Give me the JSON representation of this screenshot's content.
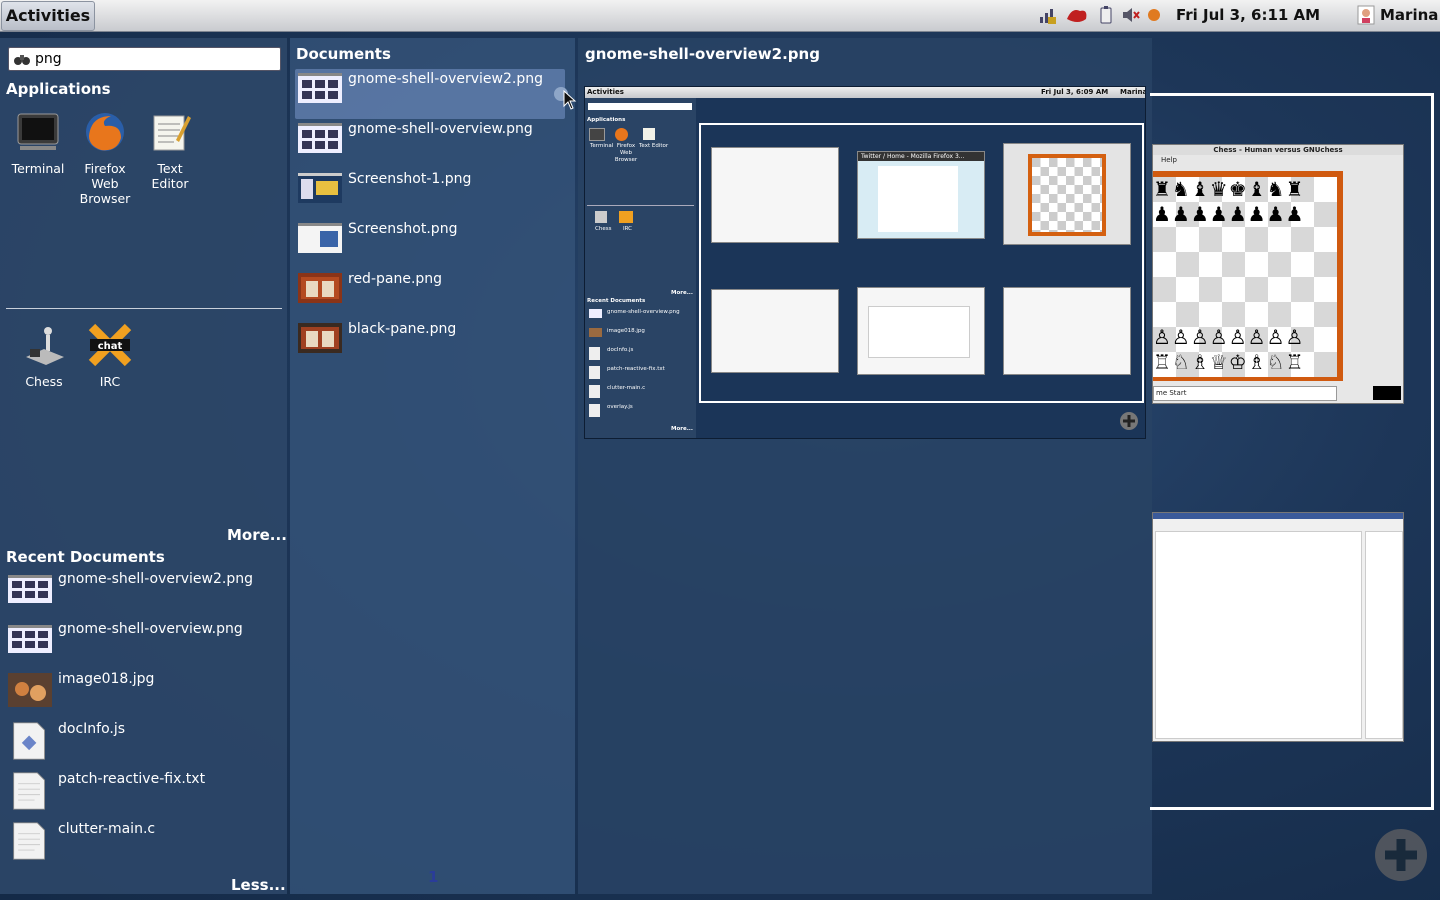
{
  "topbar": {
    "activities_label": "Activities",
    "clock": "Fri Jul  3,  6:11 AM",
    "user_name": "Marina"
  },
  "search": {
    "value": "png"
  },
  "applications": {
    "heading": "Applications",
    "items": [
      {
        "label": "Terminal"
      },
      {
        "label": "Firefox Web Browser"
      },
      {
        "label": "Text Editor"
      }
    ],
    "more_label": "More..."
  },
  "running_apps": [
    {
      "label": "Chess"
    },
    {
      "label": "IRC"
    }
  ],
  "recent_documents": {
    "heading": "Recent Documents",
    "items": [
      {
        "name": "gnome-shell-overview2.png"
      },
      {
        "name": "gnome-shell-overview.png"
      },
      {
        "name": "image018.jpg"
      },
      {
        "name": "docInfo.js"
      },
      {
        "name": "patch-reactive-fix.txt"
      },
      {
        "name": "clutter-main.c"
      }
    ],
    "less_label": "Less..."
  },
  "documents_pane": {
    "heading": "Documents",
    "items": [
      {
        "name": "gnome-shell-overview2.png"
      },
      {
        "name": "gnome-shell-overview.png"
      },
      {
        "name": "Screenshot-1.png"
      },
      {
        "name": "Screenshot.png"
      },
      {
        "name": "red-pane.png"
      },
      {
        "name": "black-pane.png"
      }
    ],
    "page_number": "1"
  },
  "preview": {
    "title": "gnome-shell-overview2.png",
    "inner_activities": "Activities",
    "inner_clock": "Fri Jul  3,  6:09 AM",
    "inner_user": "Marina",
    "inner_apps_heading": "Applications",
    "inner_apps": [
      "Terminal",
      "Firefox Web Browser",
      "Text Editor"
    ],
    "inner_running": [
      "Chess",
      "IRC"
    ],
    "inner_more": "More...",
    "inner_recent_heading": "Recent Documents",
    "inner_recent": [
      "gnome-shell-overview.png",
      "image018.jpg",
      "docInfo.js",
      "patch-reactive-fix.txt",
      "clutter-main.c",
      "overlay.js"
    ],
    "inner_more2": "More...",
    "inner_twitter_title": "Twitter / Home - Mozilla Firefox 3..."
  },
  "workspace": {
    "chess_title": "Chess - Human versus GNUchess",
    "chess_menu": "Help",
    "chess_status": "me Start"
  },
  "colors": {
    "desktop": "#1d3658",
    "panel": "#2c4668",
    "selection": "#7896c8"
  }
}
